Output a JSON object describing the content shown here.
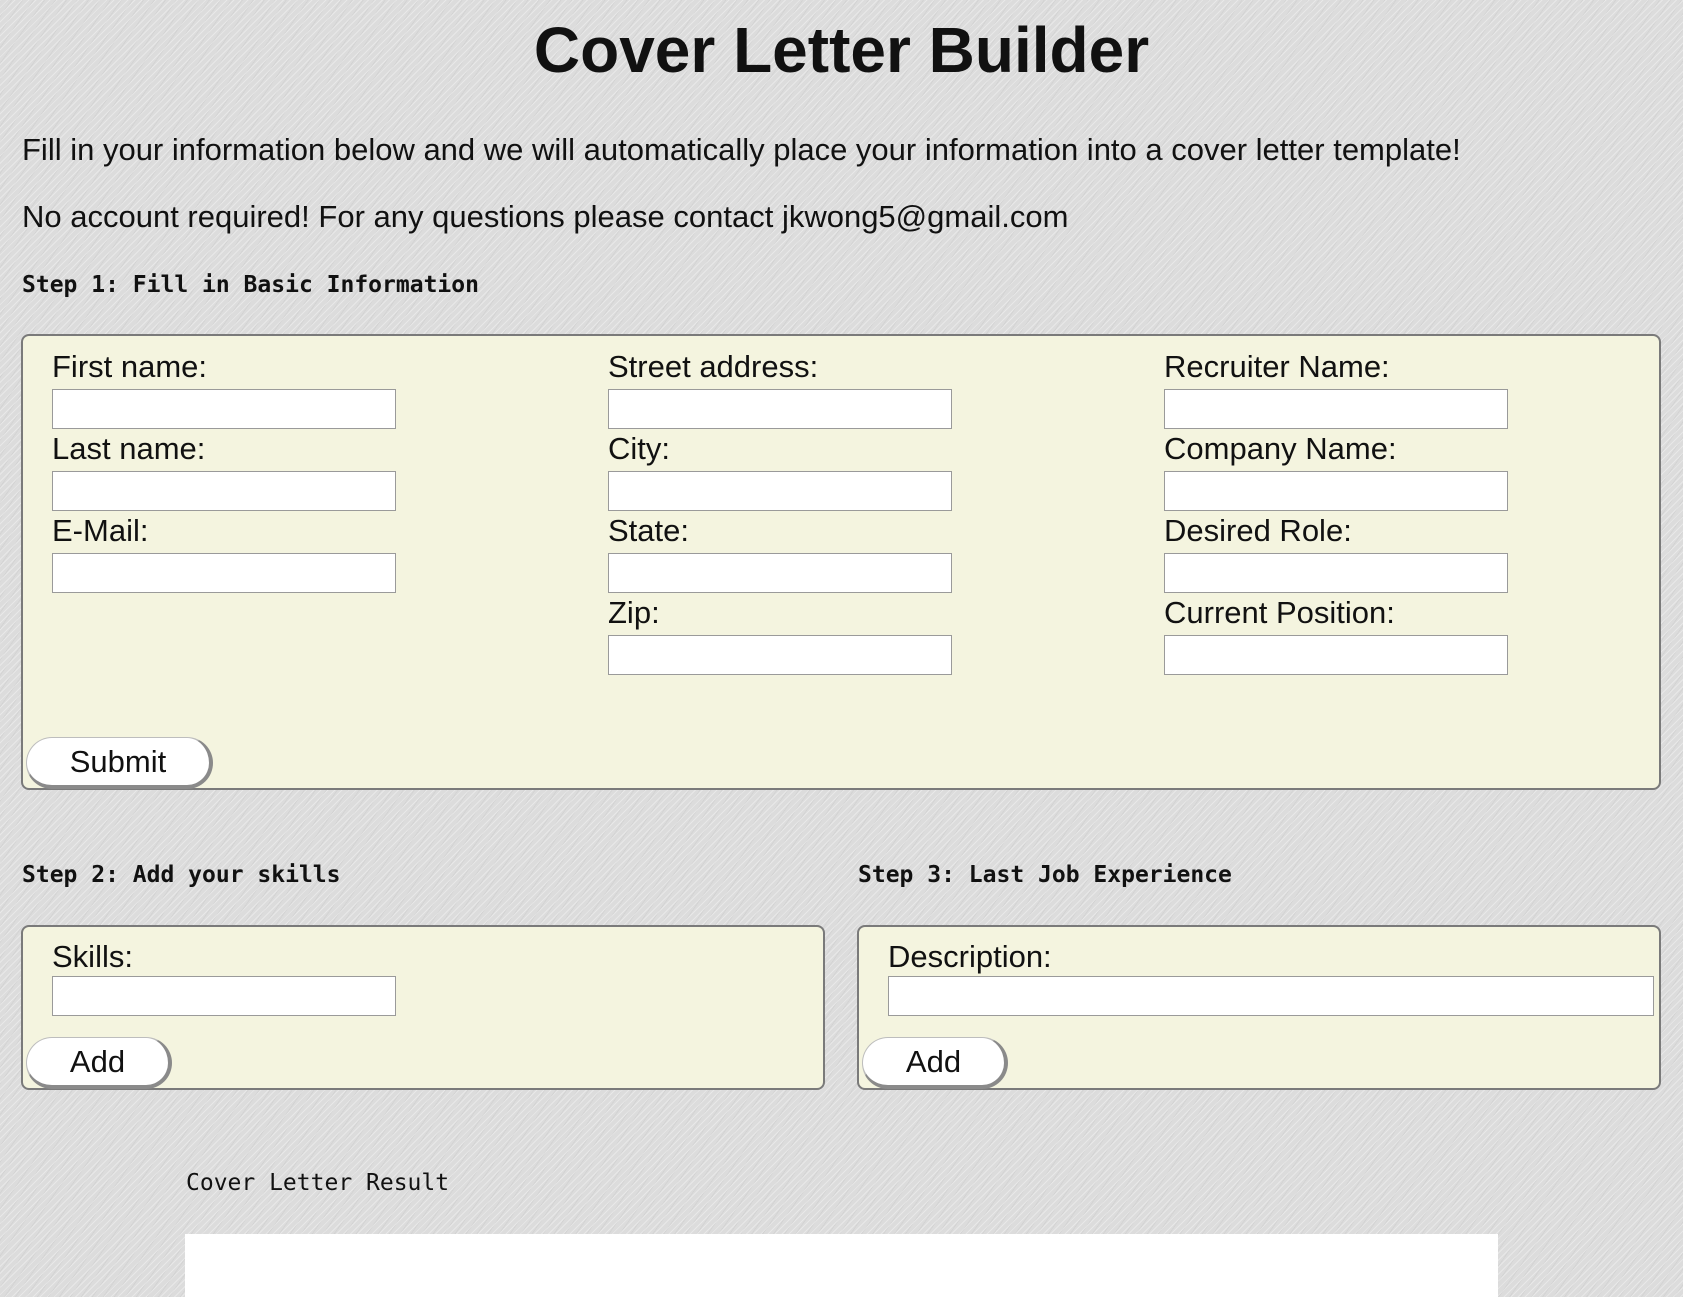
{
  "header": {
    "title": "Cover Letter Builder"
  },
  "intro": {
    "line1": "Fill in your information below and we will automatically place your information into a cover letter template!",
    "line2": "No account required! For any questions please contact jkwong5@gmail.com"
  },
  "step1": {
    "heading": "Step 1: Fill in Basic Information",
    "fields": {
      "first_name": {
        "label": "First name:",
        "value": ""
      },
      "last_name": {
        "label": "Last name:",
        "value": ""
      },
      "email": {
        "label": "E-Mail:",
        "value": ""
      },
      "street": {
        "label": "Street address:",
        "value": ""
      },
      "city": {
        "label": "City:",
        "value": ""
      },
      "state": {
        "label": "State:",
        "value": ""
      },
      "zip": {
        "label": "Zip:",
        "value": ""
      },
      "recruiter": {
        "label": "Recruiter Name:",
        "value": ""
      },
      "company": {
        "label": "Company Name:",
        "value": ""
      },
      "desired_role": {
        "label": "Desired Role:",
        "value": ""
      },
      "current_position": {
        "label": "Current Position:",
        "value": ""
      }
    },
    "submit_label": "Submit"
  },
  "step2": {
    "heading": "Step 2: Add your skills",
    "skills": {
      "label": "Skills:",
      "value": ""
    },
    "add_label": "Add"
  },
  "step3": {
    "heading": "Step 3: Last Job Experience",
    "description": {
      "label": "Description:",
      "value": ""
    },
    "add_label": "Add"
  },
  "result": {
    "heading": "Cover Letter Result",
    "content": ""
  },
  "colors": {
    "background": "#dcdcdc",
    "panel": "#f4f4df",
    "panel_border": "#7a7a7a",
    "input_background": "#ffffff"
  }
}
